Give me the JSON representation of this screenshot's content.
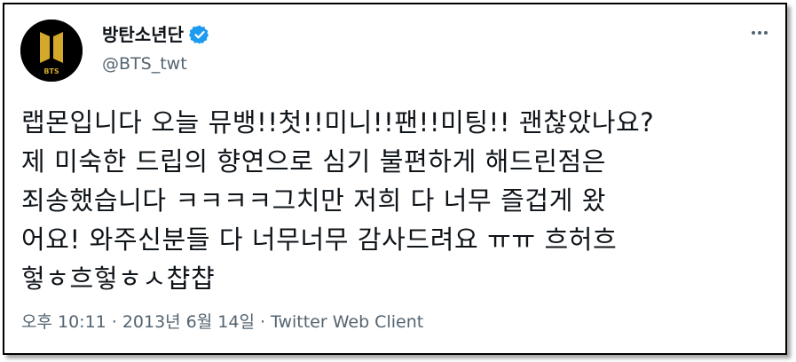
{
  "author": {
    "display_name": "방탄소년단",
    "handle": "@BTS_twt",
    "verified": true,
    "avatar_text": "BTS",
    "brand_color": "#d4a82a",
    "verified_color": "#1d9bf0"
  },
  "tweet": {
    "lines": [
      "랩몬입니다 오늘 뮤뱅!!첫!!미니!!팬!!미팅!! 괜찮았나요?",
      "제 미숙한 드립의 향연으로 심기 불편하게 해드린점은",
      "죄송했습니다 ㅋㅋㅋㅋ그치만 저희 다 너무 즐겁게 왔",
      "어요! 와주신분들 다 너무너무 감사드려요 ㅠㅠ 흐허흐",
      "헣ㅎ흐헣ㅎㅅ챱챱"
    ]
  },
  "meta": {
    "time": "오후 10:11",
    "separator": "·",
    "date": "2013년 6월 14일",
    "client": "Twitter Web Client"
  },
  "icons": {
    "more": "more-horizontal-icon",
    "verified": "verified-badge-icon",
    "avatar": "bts-logo-avatar"
  }
}
